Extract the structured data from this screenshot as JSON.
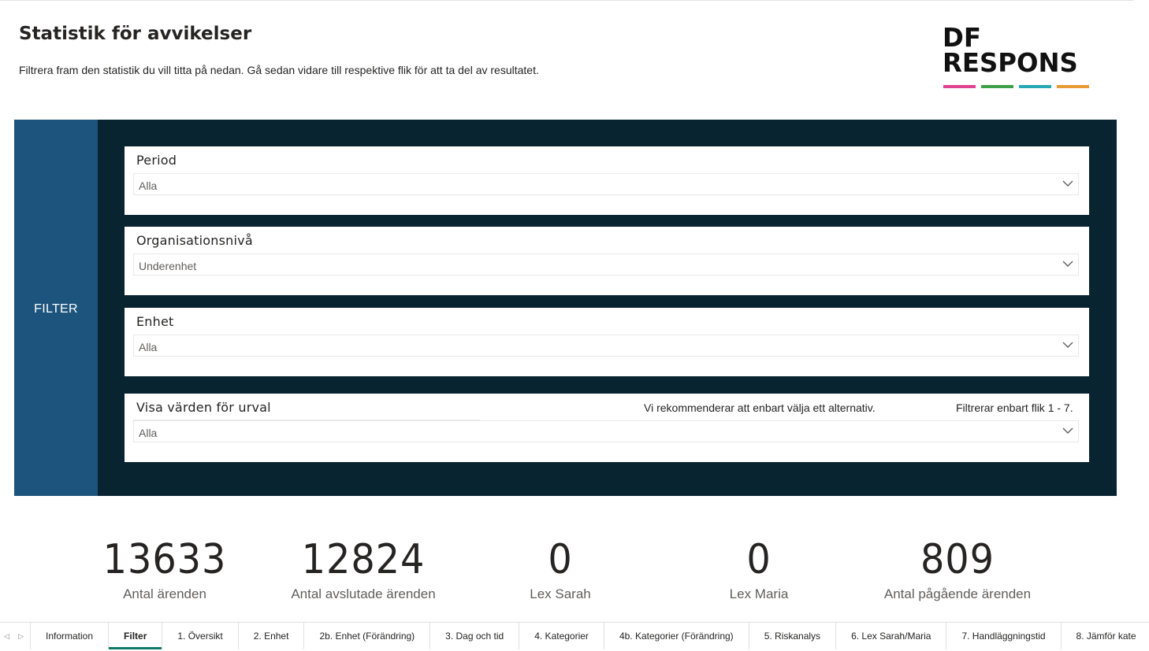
{
  "header": {
    "title": "Statistik för avvikelser",
    "subtitle": "Filtrera fram den statistik du vill titta på nedan. Gå sedan vidare till respektive flik för att ta del av resultatet.",
    "logo": {
      "line1": "DF",
      "line2": "RESPONS",
      "bar_colors": [
        "#e0428f",
        "#3da047",
        "#26a9b5",
        "#e89a34"
      ]
    }
  },
  "filter_panel": {
    "side_label": "FILTER",
    "slicers": [
      {
        "title": "Period",
        "value": "Alla"
      },
      {
        "title": "Organisationsnivå",
        "value": "Underenhet"
      },
      {
        "title": "Enhet",
        "value": "Alla"
      },
      {
        "title": "Visa värden för urval",
        "value": "Alla",
        "note_recommend": "Vi rekommenderar att enbart välja ett alternativ.",
        "note_filter": "Filtrerar enbart flik 1 - 7."
      }
    ]
  },
  "kpis": [
    {
      "value": "13633",
      "label": "Antal ärenden"
    },
    {
      "value": "12824",
      "label": "Antal avslutade ärenden"
    },
    {
      "value": "0",
      "label": "Lex Sarah"
    },
    {
      "value": "0",
      "label": "Lex Maria"
    },
    {
      "value": "809",
      "label": "Antal pågående ärenden"
    }
  ],
  "tabs": [
    "Information",
    "Filter",
    "1. Översikt",
    "2. Enhet",
    "2b. Enhet (Förändring)",
    "3. Dag och tid",
    "4. Kategorier",
    "4b. Kategorier (Förändring)",
    "5. Riskanalys",
    "6. Lex Sarah/Maria",
    "7. Handläggningstid",
    "8. Jämför kate"
  ],
  "active_tab": "Filter",
  "colors": {
    "accent_tab": "#117865",
    "panel_bg": "#082430",
    "side_bg": "#1c547d"
  }
}
